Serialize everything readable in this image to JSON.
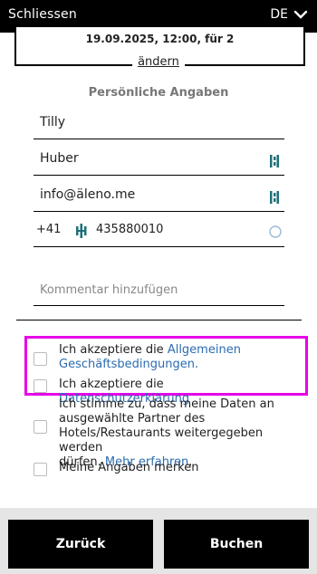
{
  "header": {
    "close_label": "Schliessen",
    "language": "DE"
  },
  "summary": {
    "booking_text": "19.09.2025, 12:00, für 2",
    "change_label": "ändern"
  },
  "form": {
    "section_title": "Persönliche Angaben",
    "first_name": "Tilly",
    "last_name": "Huber",
    "email": "info@äleno.me",
    "country_code": "+41",
    "phone": "435880010",
    "comment_placeholder": "Kommentar hinzufügen"
  },
  "consents": {
    "terms_prefix": "Ich akzeptiere die ",
    "terms_link_1": "Allgemeinen",
    "terms_link_2": "Geschäftsbedingungen.",
    "privacy_prefix": "Ich akzeptiere die ",
    "privacy_link": "Datenschutzerklärung",
    "partners_line_1": "Ich stimme zu, dass meine Daten an",
    "partners_line_2": "ausgewählte Partner des",
    "partners_line_3": "Hotels/Restaurants weitergegeben werden",
    "partners_line_4": "dürfen. ",
    "partners_more": "Mehr erfahren",
    "partners_end": ".",
    "remember": "Meine Angaben merken"
  },
  "footer": {
    "back_label": "Zurück",
    "book_label": "Buchen"
  },
  "colors": {
    "link": "#2b6cb0",
    "highlight": "#e600e6",
    "primary": "#000000"
  },
  "icons": {
    "language_dropdown": "chevron-down-icon",
    "field_status": "autofill-icon",
    "phone_flag": "phone-autofill-icon",
    "loading": "spinner-icon"
  }
}
